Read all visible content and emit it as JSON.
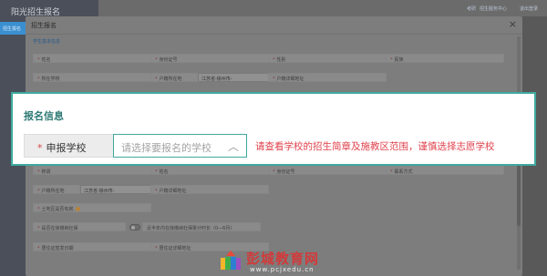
{
  "app": {
    "title": "阳光招生报名",
    "nav_active": "招生报名"
  },
  "topbar": {
    "items": [
      "考研",
      "招生服务中心",
      "退出登录"
    ]
  },
  "modal": {
    "title": "招生报名",
    "close_symbol": "×",
    "section": "学生基本信息",
    "row1": [
      "姓名",
      "身份证号",
      "性别",
      "民族"
    ],
    "row2": {
      "field1": "所在学校",
      "field2": "户籍所在地",
      "region_value": "江苏省-徐州市-",
      "field3": "户籍详细地址"
    },
    "row5": [
      "称谓",
      "姓名",
      "身份证号",
      "联系方式"
    ],
    "row6": {
      "field1": "户籍所在地",
      "region_value": "江苏省-徐州市-",
      "field2": "户籍详细地址"
    },
    "row7": {
      "field1": "土地区是否有房"
    },
    "row8": {
      "field1": "是否在徐缴纳社保",
      "hint": "近半年内在徐缴纳社保累计时长（0—6月）"
    },
    "row9": {
      "field1": "居住证签发日期",
      "field2": "居住证详细地址"
    }
  },
  "callout": {
    "title": "报名信息",
    "required_mark": "*",
    "label": "申报学校",
    "select_placeholder": "请选择要报名的学校",
    "chevron": "︿",
    "note": "请查看学校的招生简章及施教区范围，谨慎选择志愿学校"
  },
  "watermark": {
    "title": "彭城教育网",
    "url": "www.pcjxedu.cn"
  },
  "colors": {
    "accent": "#3ea99f",
    "warning": "#e0424c",
    "title": "#2f7a76",
    "watermark": "#d23a3a"
  }
}
